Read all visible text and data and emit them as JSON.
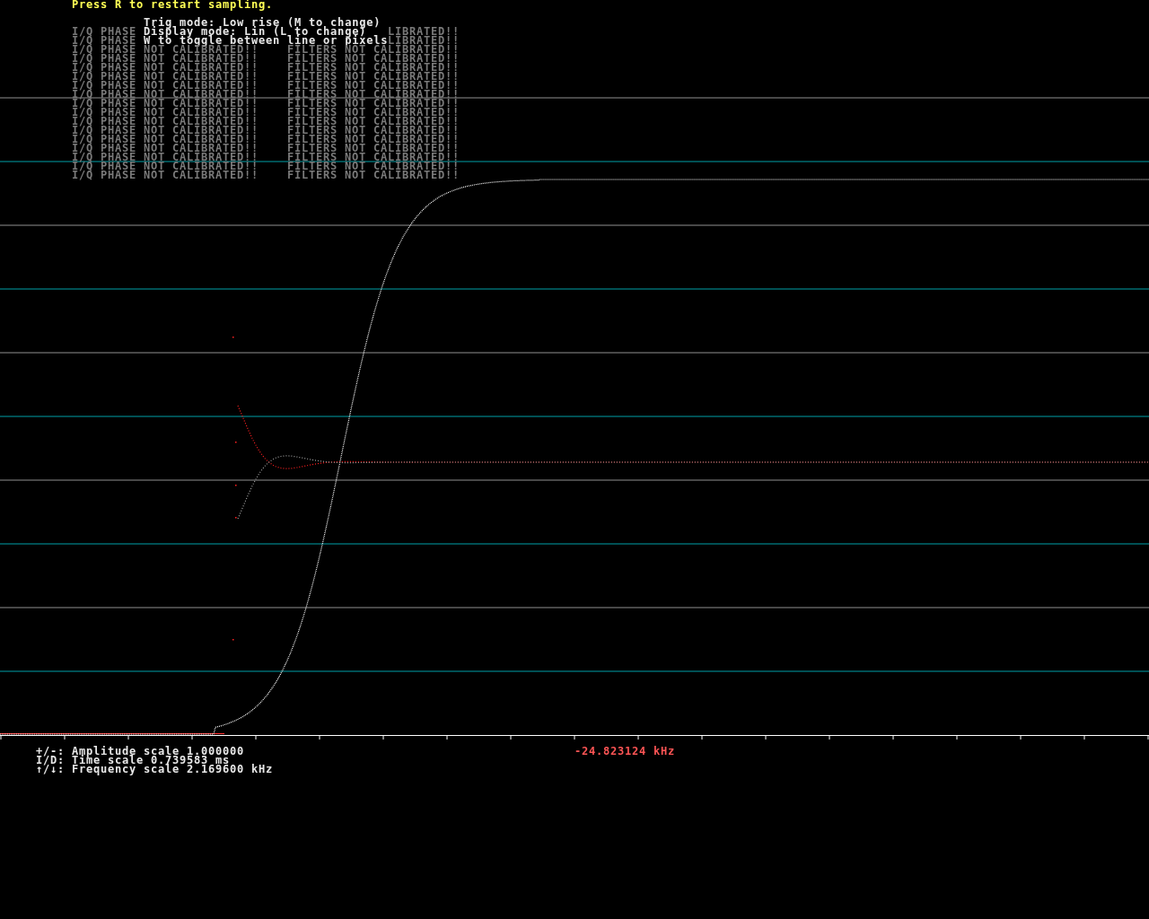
{
  "header": "Press R to restart sampling.",
  "help_lines": [
    "Trig mode: Low rise  (M to change)",
    "Display mode: Lin  (L to change)",
    "W to toggle between line or pixels"
  ],
  "warning_rows": [
    {
      "left": "I/Q PHASE",
      "right": "LIBRATED!!"
    },
    {
      "left": "I/Q PHASE",
      "right": "LIBRATED!!"
    },
    {
      "left": "I/Q PHASE NOT CALIBRATED!!",
      "right": "FILTERS NOT CALIBRATED!!"
    },
    {
      "left": "I/Q PHASE NOT CALIBRATED!!",
      "right": "FILTERS NOT CALIBRATED!!"
    },
    {
      "left": "I/Q PHASE NOT CALIBRATED!!",
      "right": "FILTERS NOT CALIBRATED!!"
    },
    {
      "left": "I/Q PHASE NOT CALIBRATED!!",
      "right": "FILTERS NOT CALIBRATED!!"
    },
    {
      "left": "I/Q PHASE NOT CALIBRATED!!",
      "right": "FILTERS NOT CALIBRATED!!"
    },
    {
      "left": "I/Q PHASE NOT CALIBRATED!!",
      "right": "FILTERS NOT CALIBRATED!!"
    },
    {
      "left": "I/Q PHASE NOT CALIBRATED!!",
      "right": "FILTERS NOT CALIBRATED!!"
    },
    {
      "left": "I/Q PHASE NOT CALIBRATED!!",
      "right": "FILTERS NOT CALIBRATED!!"
    },
    {
      "left": "I/Q PHASE NOT CALIBRATED!!",
      "right": "FILTERS NOT CALIBRATED!!"
    },
    {
      "left": "I/Q PHASE NOT CALIBRATED!!",
      "right": "FILTERS NOT CALIBRATED!!"
    },
    {
      "left": "I/Q PHASE NOT CALIBRATED!!",
      "right": "FILTERS NOT CALIBRATED!!"
    },
    {
      "left": "I/Q PHASE NOT CALIBRATED!!",
      "right": "FILTERS NOT CALIBRATED!!"
    },
    {
      "left": "I/Q PHASE NOT CALIBRATED!!",
      "right": "FILTERS NOT CALIBRATED!!"
    },
    {
      "left": "I/Q PHASE NOT CALIBRATED!!",
      "right": "FILTERS NOT CALIBRATED!!"
    },
    {
      "left": "I/Q PHASE NOT CALIBRATED!!",
      "right": "FILTERS NOT CALIBRATED!!"
    }
  ],
  "controls": [
    {
      "keys": "+/-:",
      "label": "Amplitude scale 1.000000"
    },
    {
      "keys": "I/D:",
      "label": "Time scale 0.739583 ms"
    },
    {
      "keys": "↑/↓:",
      "label": "Frequency scale 2.169600 kHz"
    }
  ],
  "frequency_readout": "-24.823124 kHz"
}
